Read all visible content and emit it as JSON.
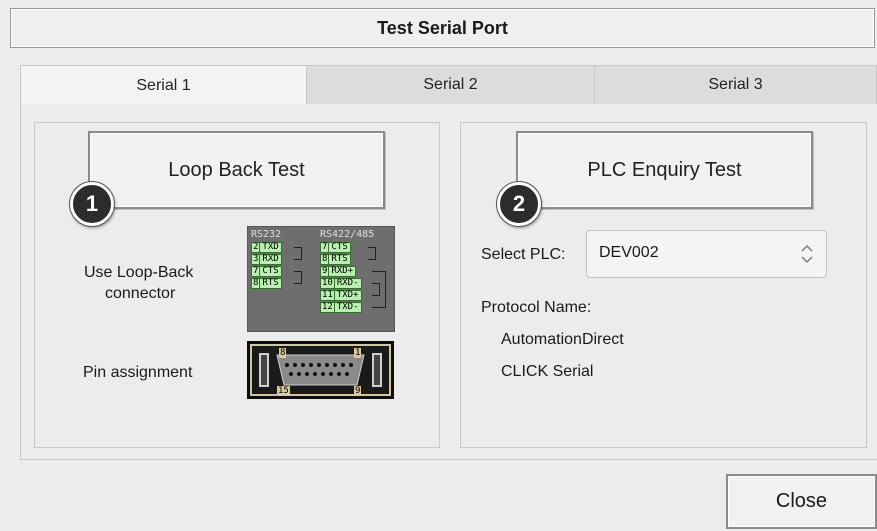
{
  "window": {
    "title": "Test Serial Port"
  },
  "tabs": [
    {
      "label": "Serial 1",
      "active": true
    },
    {
      "label": "Serial 2",
      "active": false
    },
    {
      "label": "Serial 3",
      "active": false
    }
  ],
  "loopback": {
    "button_label": "Loop Back Test",
    "badge": "1",
    "connector_text_line1": "Use Loop-Back",
    "connector_text_line2": "connector",
    "pin_assignment_label": "Pin assignment",
    "rs232_header": "RS232",
    "rs485_header": "RS422/485",
    "rs232_pins": [
      {
        "num": "2",
        "sig": "TXD"
      },
      {
        "num": "3",
        "sig": "RXD"
      },
      {
        "num": "7",
        "sig": "CTS"
      },
      {
        "num": "8",
        "sig": "RTS"
      }
    ],
    "rs485_pins": [
      {
        "num": "7",
        "sig": "CTS"
      },
      {
        "num": "8",
        "sig": "RTS"
      },
      {
        "num": "9",
        "sig": "RXD+"
      },
      {
        "num": "10",
        "sig": "RXD-"
      },
      {
        "num": "11",
        "sig": "TXD+"
      },
      {
        "num": "12",
        "sig": "TXD-"
      }
    ],
    "connector_pins": {
      "top_left": "8",
      "top_right": "1",
      "bottom_left": "15",
      "bottom_right": "9"
    }
  },
  "plc": {
    "button_label": "PLC Enquiry Test",
    "badge": "2",
    "select_label": "Select PLC:",
    "select_value": "DEV002",
    "protocol_label": "Protocol Name:",
    "protocol_line1": "AutomationDirect",
    "protocol_line2": "CLICK Serial"
  },
  "footer": {
    "close_label": "Close"
  },
  "colors": {
    "pin_fill": "#b8f0b0",
    "badge_fill": "#2c2c2c",
    "background": "#ececec"
  }
}
